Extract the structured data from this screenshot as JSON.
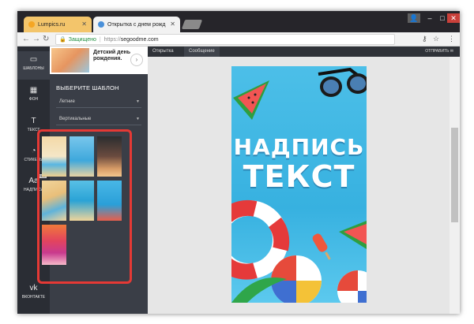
{
  "browser": {
    "tabs": [
      {
        "label": "Lumpics.ru",
        "favicon_color": "#f5a623"
      },
      {
        "label": "Открытка с днем рожд",
        "favicon_color": "#4a90d9"
      }
    ],
    "address": {
      "secure_label": "Защищено",
      "scheme": "https://",
      "host": "segoodme.com"
    },
    "window_controls": {
      "minimize": "–",
      "maximize": "□",
      "close": "✕"
    }
  },
  "sidebar": {
    "items": [
      {
        "label": "ШАБЛОНЫ",
        "icon": "templates-icon",
        "glyph": "▭"
      },
      {
        "label": "ФОН",
        "icon": "background-icon",
        "glyph": "▦"
      },
      {
        "label": "ТЕКСТ",
        "icon": "text-icon",
        "glyph": "T"
      },
      {
        "label": "СТИКЕРЫ",
        "icon": "sticker-icon",
        "glyph": "◔"
      },
      {
        "label": "НАДПИСИ",
        "icon": "inscriptions-icon",
        "glyph": "Aa",
        "badge": "PRO"
      },
      {
        "label": "ВКОНТАКТЕ",
        "icon": "vk-icon",
        "glyph": "vk"
      }
    ]
  },
  "panel": {
    "banner": {
      "text": "Детский день рождения.",
      "arrow": "›"
    },
    "title": "ВЫБЕРИТЕ ШАБЛОН",
    "dropdowns": [
      {
        "value": "Летние"
      },
      {
        "value": "Вертикальные"
      }
    ]
  },
  "editor": {
    "tabs": [
      {
        "label": "Открытка"
      },
      {
        "label": "Сообщение"
      }
    ],
    "send_label": "ОТПРАВИТЬ",
    "card": {
      "line1": "НАДПИСЬ",
      "line2": "ТЕКСТ"
    }
  },
  "colors": {
    "highlight": "#e53935",
    "card_bg": "#37b1e0",
    "sidebar_bg": "#2a2d34"
  }
}
